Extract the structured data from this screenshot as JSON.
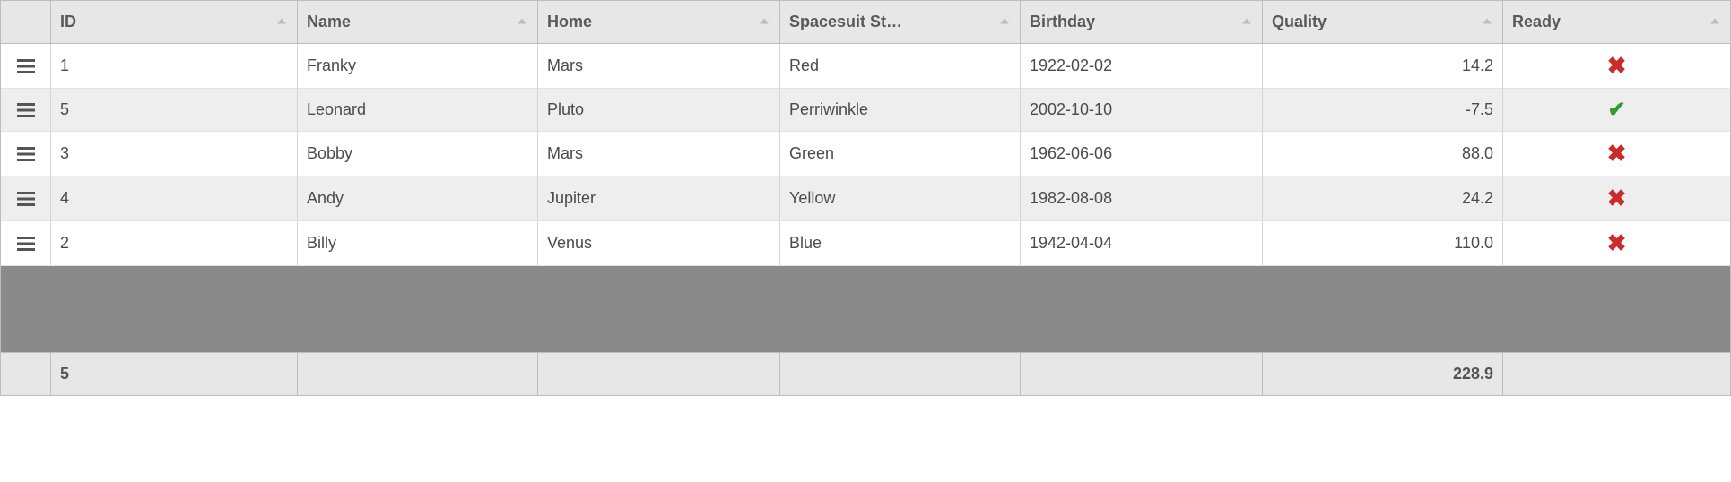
{
  "columns": {
    "id": "ID",
    "name": "Name",
    "home": "Home",
    "spacesuit": "Spacesuit St…",
    "birthday": "Birthday",
    "quality": "Quality",
    "ready": "Ready"
  },
  "rows": [
    {
      "id": "1",
      "name": "Franky",
      "home": "Mars",
      "spacesuit": "Red",
      "birthday": "1922-02-02",
      "quality": "14.2",
      "ready": false
    },
    {
      "id": "5",
      "name": "Leonard",
      "home": "Pluto",
      "spacesuit": "Perriwinkle",
      "birthday": "2002-10-10",
      "quality": "-7.5",
      "ready": true
    },
    {
      "id": "3",
      "name": "Bobby",
      "home": "Mars",
      "spacesuit": "Green",
      "birthday": "1962-06-06",
      "quality": "88.0",
      "ready": false
    },
    {
      "id": "4",
      "name": "Andy",
      "home": "Jupiter",
      "spacesuit": "Yellow",
      "birthday": "1982-08-08",
      "quality": "24.2",
      "ready": false
    },
    {
      "id": "2",
      "name": "Billy",
      "home": "Venus",
      "spacesuit": "Blue",
      "birthday": "1942-04-04",
      "quality": "110.0",
      "ready": false
    }
  ],
  "footer": {
    "count": "5",
    "quality_sum": "228.9"
  },
  "icons": {
    "drag_handle": "drag-handle-icon",
    "sort_asc": "sort-asc-icon",
    "ready_true": "✔",
    "ready_false": "✖"
  },
  "colors": {
    "ready_true": "#2e9e2e",
    "ready_false": "#cc2b2b"
  }
}
